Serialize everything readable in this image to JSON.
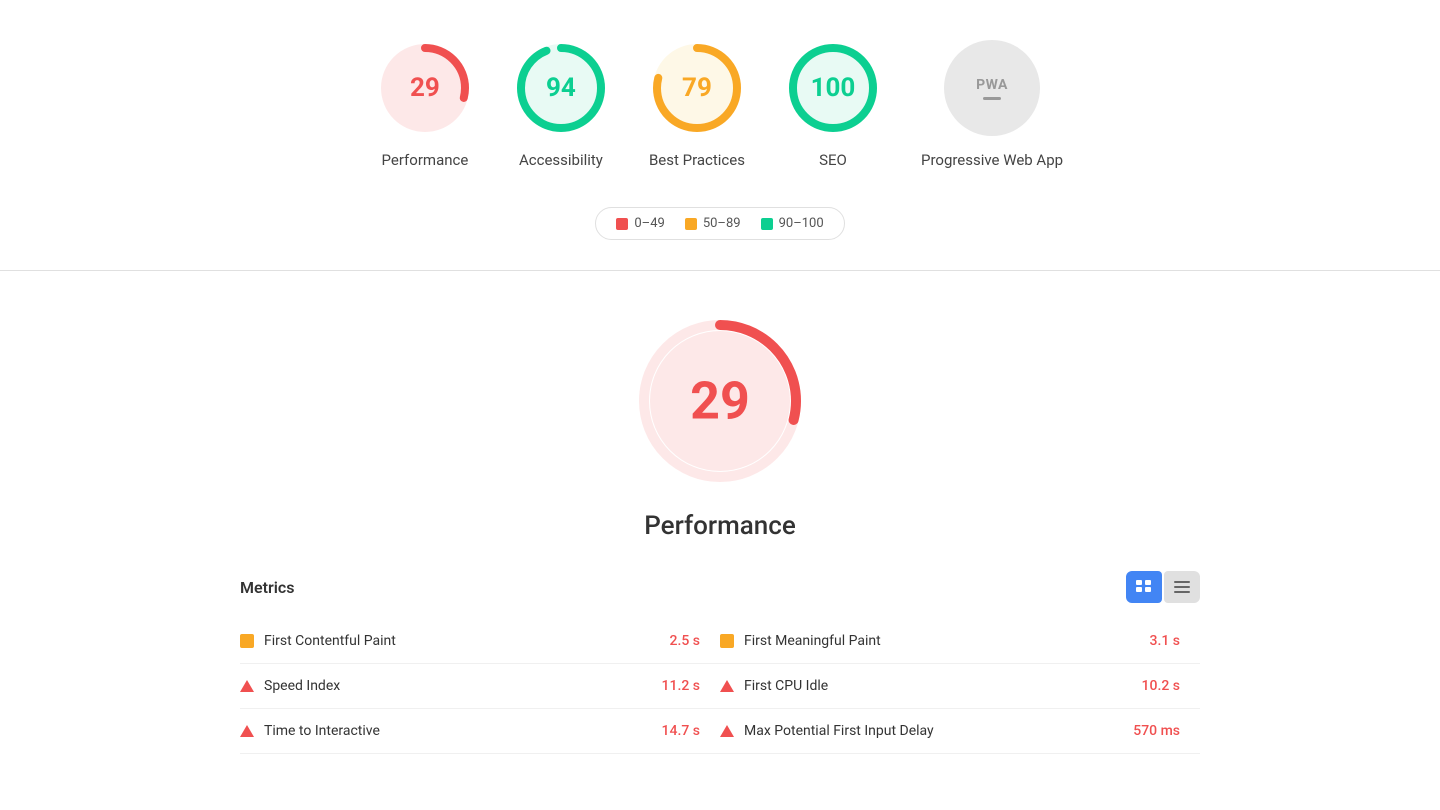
{
  "scores": [
    {
      "id": "performance",
      "label": "Performance",
      "value": 29,
      "color": "#f05050",
      "trackColor": "#fde8e8",
      "bgColor": "#fde8e8",
      "type": "gauge",
      "percentage": 29
    },
    {
      "id": "accessibility",
      "label": "Accessibility",
      "value": 94,
      "color": "#0ccf91",
      "trackColor": "#e8faf4",
      "bgColor": "#e8faf4",
      "type": "gauge",
      "percentage": 94
    },
    {
      "id": "best-practices",
      "label": "Best Practices",
      "value": 79,
      "color": "#f9a825",
      "trackColor": "#fef8e7",
      "bgColor": "#fef8e7",
      "type": "gauge",
      "percentage": 79
    },
    {
      "id": "seo",
      "label": "SEO",
      "value": 100,
      "color": "#0ccf91",
      "trackColor": "#e8faf4",
      "bgColor": "#e8faf4",
      "type": "gauge",
      "percentage": 100
    },
    {
      "id": "pwa",
      "label": "Progressive Web App",
      "value": "PWA",
      "type": "pwa"
    }
  ],
  "legend": {
    "items": [
      {
        "id": "low",
        "range": "0–49",
        "color": "#f05050"
      },
      {
        "id": "mid",
        "range": "50–89",
        "color": "#f9a825"
      },
      {
        "id": "high",
        "range": "90–100",
        "color": "#0ccf91"
      }
    ]
  },
  "large_score": {
    "value": 29,
    "color": "#f05050"
  },
  "performance_title": "Performance",
  "metrics": {
    "title": "Metrics",
    "left": [
      {
        "name": "First Contentful Paint",
        "value": "2.5 s",
        "icon": "orange-square"
      },
      {
        "name": "Speed Index",
        "value": "11.2 s",
        "icon": "red-triangle"
      },
      {
        "name": "Time to Interactive",
        "value": "14.7 s",
        "icon": "red-triangle"
      }
    ],
    "right": [
      {
        "name": "First Meaningful Paint",
        "value": "3.1 s",
        "icon": "orange-square"
      },
      {
        "name": "First CPU Idle",
        "value": "10.2 s",
        "icon": "red-triangle"
      },
      {
        "name": "Max Potential First Input Delay",
        "value": "570 ms",
        "icon": "red-triangle"
      }
    ]
  },
  "view_toggle": {
    "grid_icon": "⊟",
    "list_icon": "≡"
  }
}
